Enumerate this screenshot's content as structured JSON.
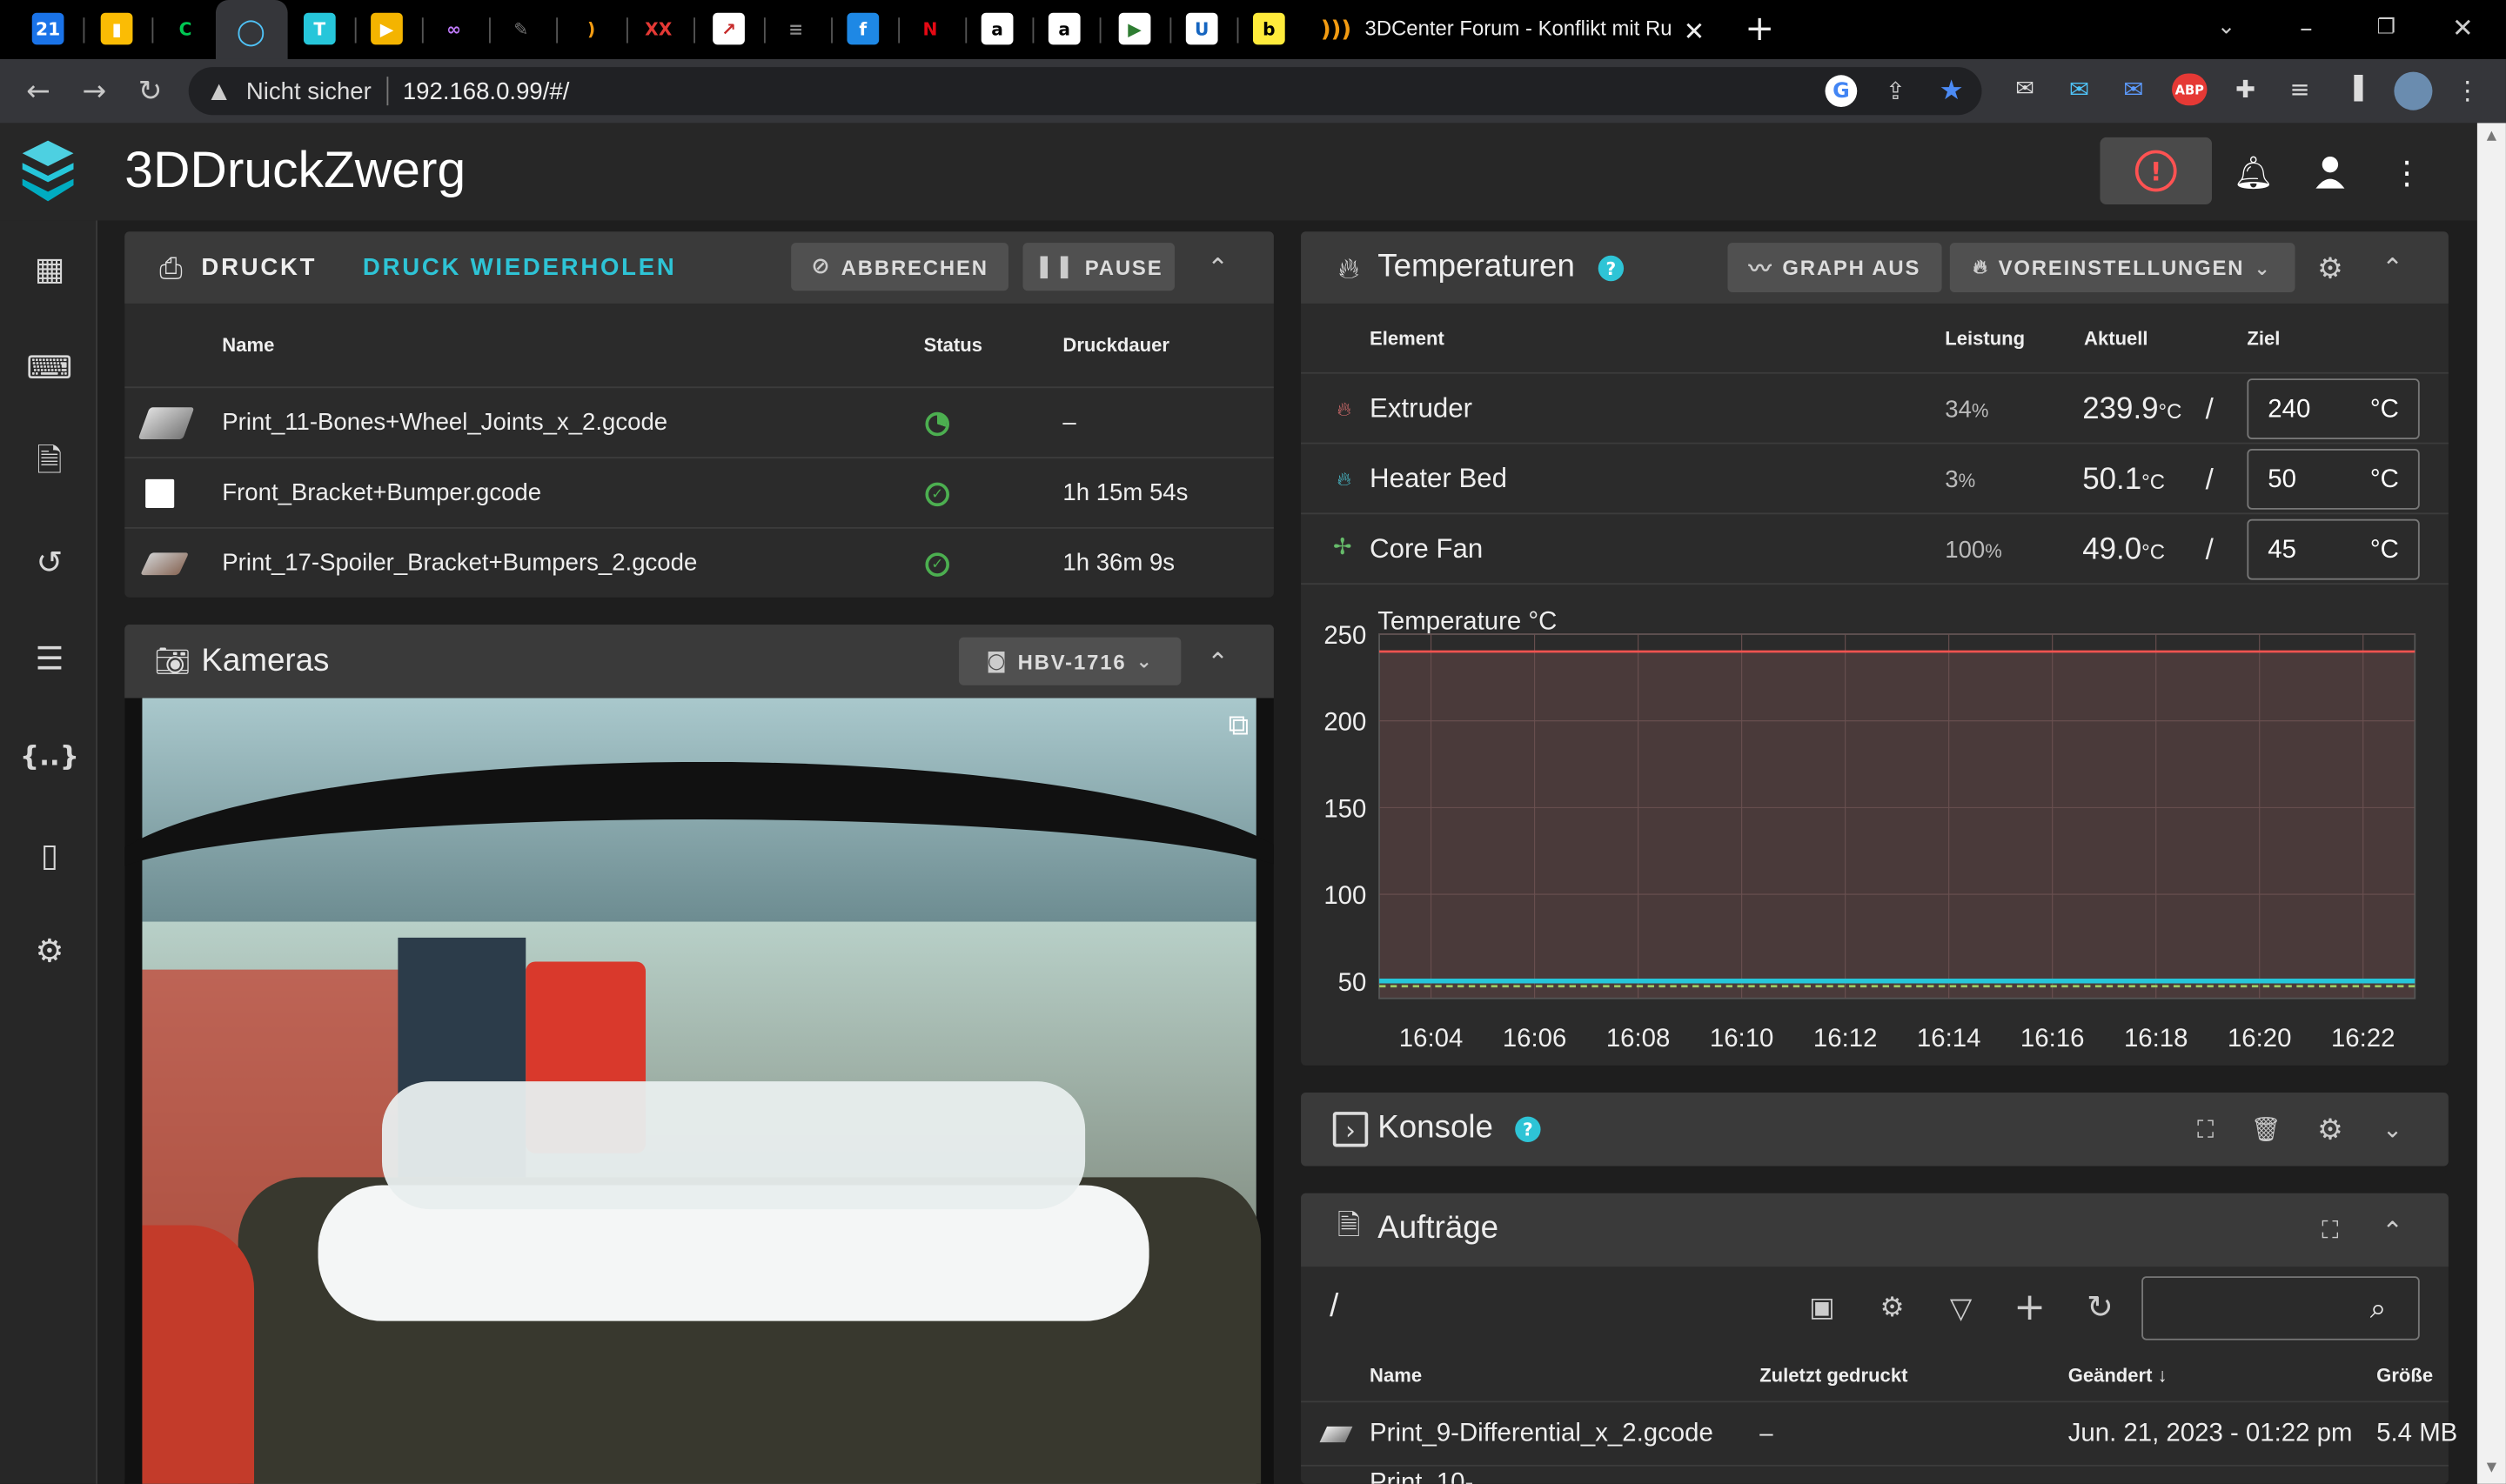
{
  "browser": {
    "active_tab_title": "3DCenter Forum - Konflikt mit Ru",
    "security_label": "Nicht sicher",
    "url": "192.168.0.99/#/",
    "tab_icons": [
      {
        "name": "calendar-icon",
        "glyph": "21",
        "bg": "#1a73e8",
        "fg": "#fff"
      },
      {
        "name": "keep-icon",
        "glyph": "▮",
        "bg": "#fbbc04",
        "fg": "#fff"
      },
      {
        "name": "green-c-icon",
        "glyph": "C",
        "bg": "#000",
        "fg": "#00c853"
      },
      {
        "name": "ring-icon",
        "glyph": "◯",
        "bg": "#35363a",
        "fg": "#4fc3f7"
      },
      {
        "name": "t-icon",
        "glyph": "T",
        "bg": "#26c6da",
        "fg": "#fff"
      },
      {
        "name": "slides-icon",
        "glyph": "▶",
        "bg": "#f4b400",
        "fg": "#fff"
      },
      {
        "name": "link-icon",
        "glyph": "∞",
        "bg": "#000",
        "fg": "#c27cff"
      },
      {
        "name": "scribble-icon",
        "glyph": "✎",
        "bg": "#000",
        "fg": "#777"
      },
      {
        "name": "rss-icon",
        "glyph": ")",
        "bg": "#000",
        "fg": "#f39c12"
      },
      {
        "name": "xx-icon",
        "glyph": "XX",
        "bg": "#000",
        "fg": "#e53935"
      },
      {
        "name": "chart-tab-icon",
        "glyph": "↗",
        "bg": "#fff",
        "fg": "#c62828"
      },
      {
        "name": "stripe-icon",
        "glyph": "≡",
        "bg": "#000",
        "fg": "#888"
      },
      {
        "name": "f-icon",
        "glyph": "f",
        "bg": "#1e88e5",
        "fg": "#fff"
      },
      {
        "name": "netflix-icon",
        "glyph": "N",
        "bg": "#000",
        "fg": "#e50914"
      },
      {
        "name": "amazon-icon",
        "glyph": "a",
        "bg": "#fff",
        "fg": "#000"
      },
      {
        "name": "amazon-2-icon",
        "glyph": "a",
        "bg": "#fff",
        "fg": "#000"
      },
      {
        "name": "play-icon",
        "glyph": "▶",
        "bg": "#fff",
        "fg": "#2e7d32"
      },
      {
        "name": "u-icon",
        "glyph": "U",
        "bg": "#fff",
        "fg": "#1565c0"
      },
      {
        "name": "doc-icon",
        "glyph": "b",
        "bg": "#ffeb3b",
        "fg": "#000"
      }
    ]
  },
  "app": {
    "title": "3DDruckZwerg",
    "accent": "#2ec4d6",
    "emergency_color": "#ff5252"
  },
  "sidenav": [
    "dashboard-icon",
    "console-icon",
    "files-icon",
    "history-icon",
    "tune-icon",
    "code-braces-icon",
    "device-icon",
    "settings-icon"
  ],
  "print": {
    "status": "DRUCKT",
    "reprint": "DRUCK WIEDERHOLEN",
    "cancel": "ABBRECHEN",
    "pause": "PAUSE",
    "columns": [
      "Name",
      "Status",
      "Druckdauer"
    ],
    "rows": [
      {
        "name": "Print_11-Bones+Wheel_Joints_x_2.gcode",
        "status": "printing",
        "duration": "–"
      },
      {
        "name": "Front_Bracket+Bumper.gcode",
        "status": "done",
        "duration": "1h 15m 54s"
      },
      {
        "name": "Print_17-Spoiler_Bracket+Bumpers_2.gcode",
        "status": "done",
        "duration": "1h 36m 9s"
      }
    ]
  },
  "cameras": {
    "title": "Kameras",
    "camera": "HBV-1716"
  },
  "temps": {
    "title": "Temperaturen",
    "graph_btn": "GRAPH AUS",
    "presets_btn": "VOREINSTELLUNGEN",
    "columns": [
      "Element",
      "Leistung",
      "Aktuell",
      "Ziel"
    ],
    "rows": [
      {
        "name": "Extruder",
        "power": "34",
        "current": "239.9",
        "target": "240",
        "color": "#e57373"
      },
      {
        "name": "Heater Bed",
        "power": "3",
        "current": "50.1",
        "target": "50",
        "color": "#4dd0e1"
      },
      {
        "name": "Core Fan",
        "power": "100",
        "current": "49.0",
        "target": "45",
        "color": "#66bb6a"
      }
    ],
    "percent": "%",
    "unit": "°C",
    "unit_small": "°C",
    "sep": "/"
  },
  "chart_data": {
    "type": "line",
    "title": "",
    "ylabel": "Temperature °C",
    "ylim": [
      40,
      250
    ],
    "yticks": [
      "250",
      "200",
      "150",
      "100",
      "50"
    ],
    "yticks_num": [
      250,
      200,
      150,
      100,
      50
    ],
    "xticks": [
      "16:04",
      "16:06",
      "16:08",
      "16:10",
      "16:12",
      "16:14",
      "16:16",
      "16:18",
      "16:20",
      "16:22"
    ],
    "xlim": [
      "16:03",
      "16:23"
    ],
    "series": [
      {
        "name": "Extruder",
        "color": "#ef5350",
        "values": [
          240,
          240,
          240,
          240,
          240,
          240,
          240,
          240,
          240,
          240
        ]
      },
      {
        "name": "Heater Bed",
        "color": "#26c6da",
        "values": [
          50,
          50,
          50,
          50,
          50,
          50,
          50,
          50,
          50,
          50
        ]
      },
      {
        "name": "Core Fan",
        "color": "#9ccc65",
        "values": [
          47,
          47,
          47,
          47,
          47,
          47,
          47,
          47,
          47,
          47
        ]
      }
    ]
  },
  "console": {
    "title": "Konsole"
  },
  "jobs": {
    "title": "Aufträge",
    "path": "/",
    "columns": [
      "Name",
      "Zuletzt gedruckt",
      "Geändert",
      "Größe"
    ],
    "rows": [
      {
        "name": "Print_9-Differential_x_2.gcode",
        "last": "–",
        "modified": "Jun. 21, 2023 - 01:22 pm",
        "size": "5.4 MB"
      },
      {
        "name": "Print_10-",
        "last": "",
        "modified": "",
        "size": ""
      }
    ]
  }
}
